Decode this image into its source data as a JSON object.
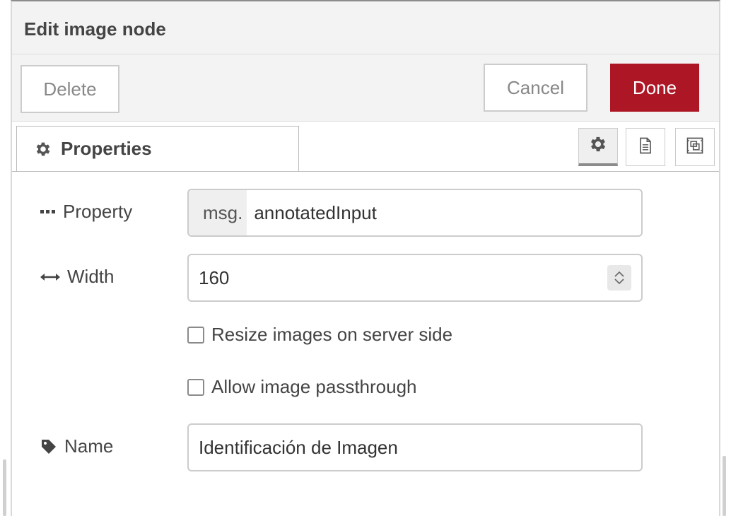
{
  "dialog": {
    "title": "Edit image node"
  },
  "toolbar": {
    "delete_label": "Delete",
    "cancel_label": "Cancel",
    "done_label": "Done"
  },
  "tabs": {
    "properties_label": "Properties",
    "icons": [
      "gear-icon",
      "document-icon",
      "layout-icon"
    ]
  },
  "form": {
    "property": {
      "label": "Property",
      "prefix": "msg.",
      "value": "annotatedInput"
    },
    "width": {
      "label": "Width",
      "value": "160"
    },
    "resize_checkbox": {
      "label": "Resize images on server side",
      "checked": false
    },
    "passthrough_checkbox": {
      "label": "Allow image passthrough",
      "checked": false
    },
    "name": {
      "label": "Name",
      "value": "Identificación de Imagen"
    }
  },
  "colors": {
    "done_button": "#ad1625",
    "header_bg": "#f3f3f3"
  }
}
